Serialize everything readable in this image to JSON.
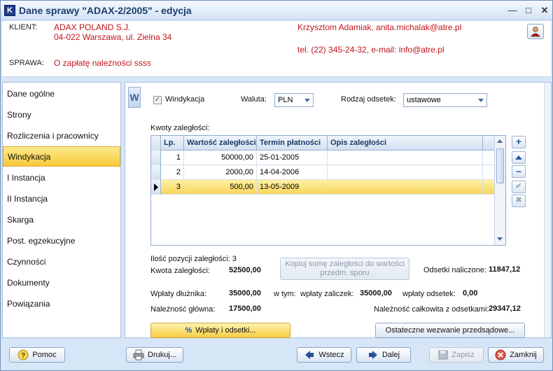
{
  "window": {
    "title": "Dane sprawy \"ADAX-2/2005\" - edycja",
    "app_icon": "K"
  },
  "header": {
    "client_label": "KLIENT:",
    "client_name": "ADAX POLAND S.J.",
    "client_address": "04-022 Warszawa, ul. Zielna 34",
    "contact": "Krzysztom Adamiak, anita.michalak@atre.pl",
    "phone": "tel. (22) 345-24-32, e-mail: info@atre.pl",
    "case_label": "SPRAWA:",
    "case_value": "O zapłatę należności ssss"
  },
  "nav": {
    "items": [
      {
        "label": "Dane ogólne"
      },
      {
        "label": "Strony"
      },
      {
        "label": "Rozliczenia i pracownicy"
      },
      {
        "label": "Windykacja"
      },
      {
        "label": "I Instancja"
      },
      {
        "label": "II Instancja"
      },
      {
        "label": "Skarga"
      },
      {
        "label": "Post. egzekucyjne"
      },
      {
        "label": "Czynności"
      },
      {
        "label": "Dokumenty"
      },
      {
        "label": "Powiązania"
      }
    ],
    "active_index": 3
  },
  "main": {
    "side_tab": "W",
    "windykacja_label": "Windykacja",
    "windykacja_checked": true,
    "waluta_label": "Waluta:",
    "waluta_value": "PLN",
    "odsetki_label": "Rodzaj odsetek:",
    "odsetki_value": "ustawowe",
    "kwoty_label": "Kwoty zaległości:",
    "grid": {
      "columns": [
        "Lp.",
        "Wartość zaległości",
        "Termin płatności",
        "Opis zaległości"
      ],
      "rows": [
        {
          "lp": "1",
          "wartosc": "50000,00",
          "termin": "25-01-2005",
          "opis": ""
        },
        {
          "lp": "2",
          "wartosc": "2000,00",
          "termin": "14-04-2006",
          "opis": ""
        },
        {
          "lp": "3",
          "wartosc": "500,00",
          "termin": "13-05-2009",
          "opis": ""
        }
      ],
      "selected_row": 2
    },
    "ilosc_label": "Ilość pozycji zaległości: 3",
    "kwota_label": "Kwota zaległości:",
    "kwota_value": "52500,00",
    "kopiuj_line1": "Kopiuj sumę zaległości do wartości",
    "kopiuj_line2": "przedm. sporu",
    "odsetki_nal_label": "Odsetki naliczone:",
    "odsetki_nal_value": "11847,12",
    "wplaty_label": "Wpłaty dłużnika:",
    "wplaty_value": "35000,00",
    "wtym_label": "w tym:",
    "zaliczek_label": "wpłaty zaliczek:",
    "zaliczek_value": "35000,00",
    "wpl_odsetek_label": "wpłaty odsetek:",
    "wpl_odsetek_value": "0,00",
    "glowna_label": "Należność główna:",
    "glowna_value": "17500,00",
    "calkowita_label": "Należność całkowita z odsetkami:",
    "calkowita_value": "29347,12",
    "wplaty_btn": "Wpłaty i odsetki...",
    "wplaty_btn_icon": "%",
    "wezwanie_btn": "Ostateczne wezwanie przedsądowe..."
  },
  "footer": {
    "pomoc": "Pomoc",
    "drukuj": "Drukuj...",
    "wstecz": "Wstecz",
    "dalej": "Dalej",
    "zapisz": "Zapisz",
    "zamknij": "Zamknij"
  },
  "colors": {
    "accent_red": "#c0141a",
    "selected_yellow": "#f9d65a"
  }
}
